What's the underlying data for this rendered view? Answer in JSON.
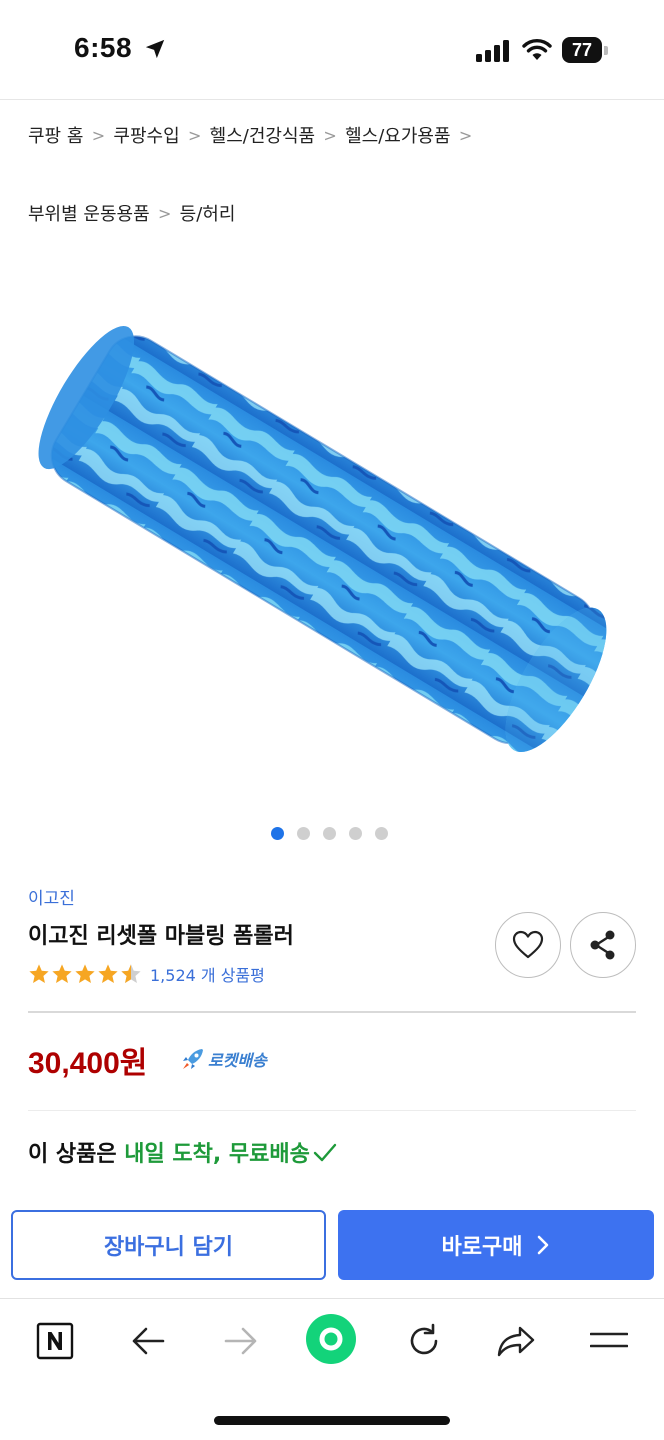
{
  "status_bar": {
    "time": "6:58",
    "battery": "77"
  },
  "breadcrumb": {
    "row1": [
      "쿠팡 홈",
      "쿠팡수입",
      "헬스/건강식품",
      "헬스/요가용품"
    ],
    "row2": [
      "부위별 운동용품",
      "등/허리"
    ]
  },
  "product": {
    "image_icon": "blue-marbled-foam-roller",
    "carousel_count": 5,
    "carousel_active": 1,
    "brand": "이고진",
    "title": "이고진 리셋폴 마블링 폼롤러",
    "rating": 4.5,
    "review_count": "1,524 개 상품평",
    "price": "30,400",
    "price_unit": "원",
    "rocket_label": "로켓배송",
    "delivery_prefix": "이 상품은 ",
    "delivery_highlight": "내일 도착, 무료배송"
  },
  "actions": {
    "cart_label": "장바구니 담기",
    "buy_label": "바로구매"
  },
  "toolbar": [
    "naver-icon",
    "back-icon",
    "forward-icon",
    "home-green-icon",
    "refresh-icon",
    "share-icon",
    "menu-icon"
  ],
  "colors": {
    "accent_blue": "#3d72f0",
    "price_red": "#ae0000",
    "delivery_green": "#1e9a3a",
    "star": "#f6a623"
  }
}
